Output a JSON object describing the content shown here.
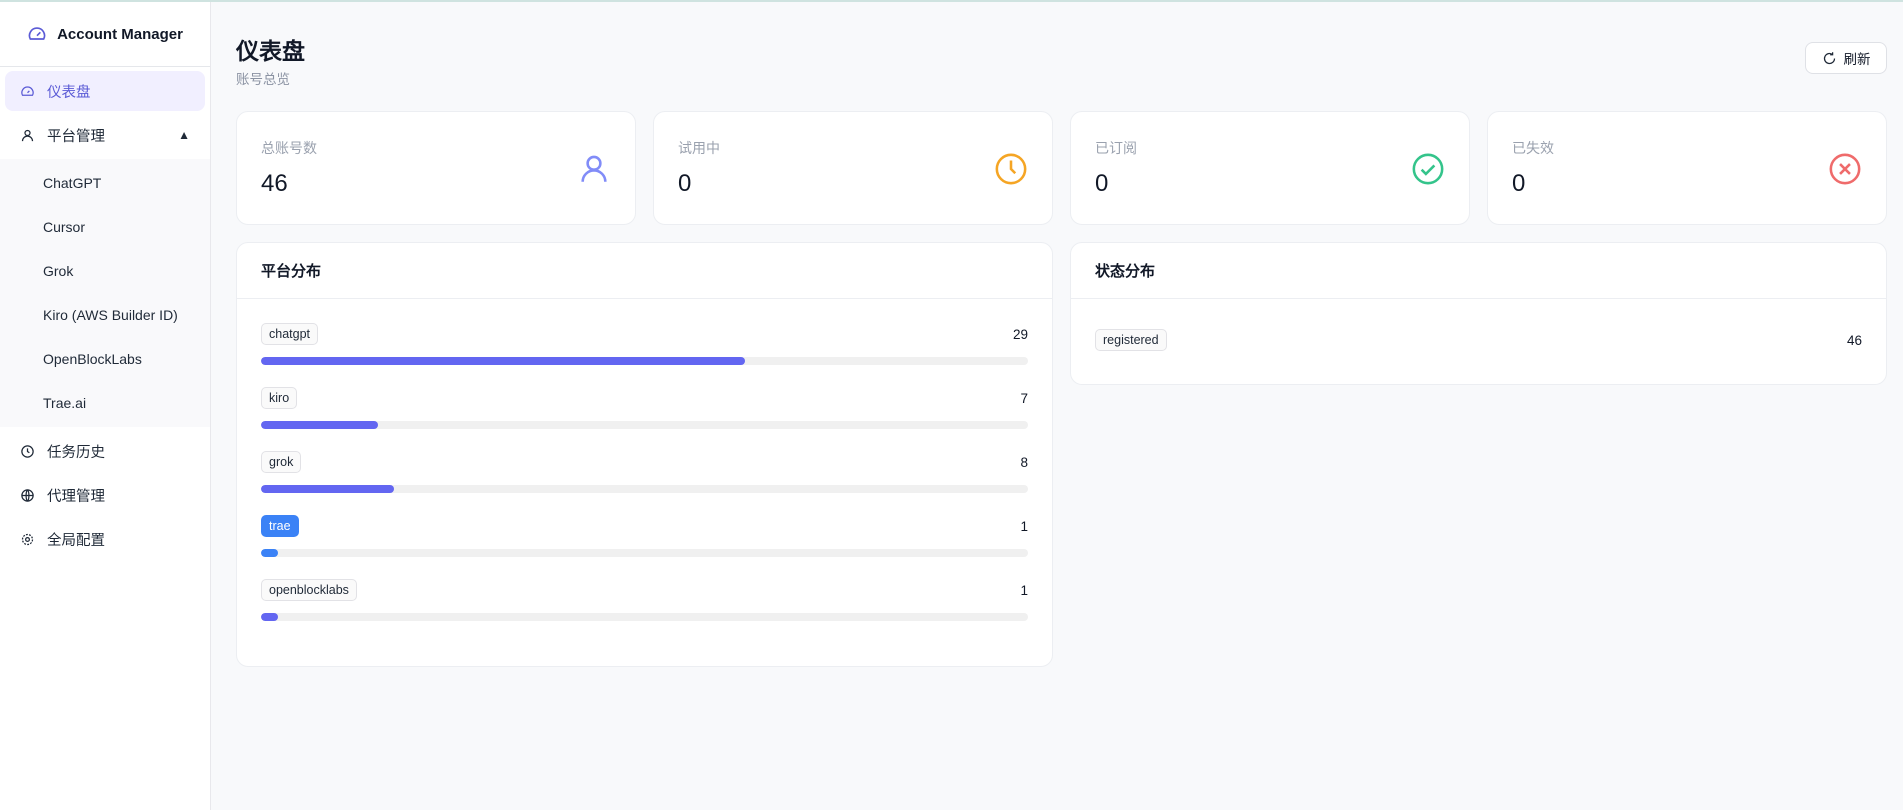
{
  "app": {
    "title": "Account Manager"
  },
  "sidebar": {
    "dashboard": "仪表盘",
    "platform": "平台管理",
    "platforms": [
      "ChatGPT",
      "Cursor",
      "Grok",
      "Kiro (AWS Builder ID)",
      "OpenBlockLabs",
      "Trae.ai"
    ],
    "history": "任务历史",
    "proxy": "代理管理",
    "config": "全局配置"
  },
  "header": {
    "title": "仪表盘",
    "subtitle": "账号总览",
    "refresh": "刷新"
  },
  "stats": [
    {
      "label": "总账号数",
      "value": "46",
      "icon": "user-icon",
      "color": "#818cf8"
    },
    {
      "label": "试用中",
      "value": "0",
      "icon": "clock-icon",
      "color": "#f5a524"
    },
    {
      "label": "已订阅",
      "value": "0",
      "icon": "check-circle-icon",
      "color": "#34c48b"
    },
    {
      "label": "已失效",
      "value": "0",
      "icon": "x-circle-icon",
      "color": "#ef6b6b"
    }
  ],
  "platform_dist": {
    "title": "平台分布",
    "total": 46,
    "rows": [
      {
        "name": "chatgpt",
        "count": 29,
        "color": "#6366f1"
      },
      {
        "name": "kiro",
        "count": 7,
        "color": "#6366f1"
      },
      {
        "name": "grok",
        "count": 8,
        "color": "#6366f1"
      },
      {
        "name": "trae",
        "count": 1,
        "color": "#3b82f6",
        "highlight": true
      },
      {
        "name": "openblocklabs",
        "count": 1,
        "color": "#6366f1"
      }
    ]
  },
  "status_dist": {
    "title": "状态分布",
    "rows": [
      {
        "name": "registered",
        "count": 46
      }
    ]
  }
}
